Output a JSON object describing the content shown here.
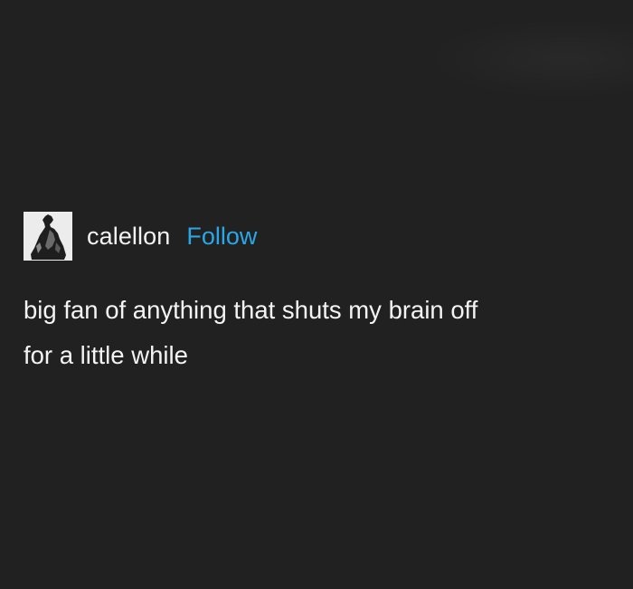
{
  "post": {
    "author": {
      "username": "calellon",
      "follow_label": "Follow",
      "avatar_icon": "statue-avatar-icon"
    },
    "body_lines": [
      "big fan of anything that shuts my brain off",
      "for a little while"
    ]
  },
  "colors": {
    "background": "#212121",
    "text": "#f4f4f4",
    "follow_link": "#2aa7e6"
  }
}
